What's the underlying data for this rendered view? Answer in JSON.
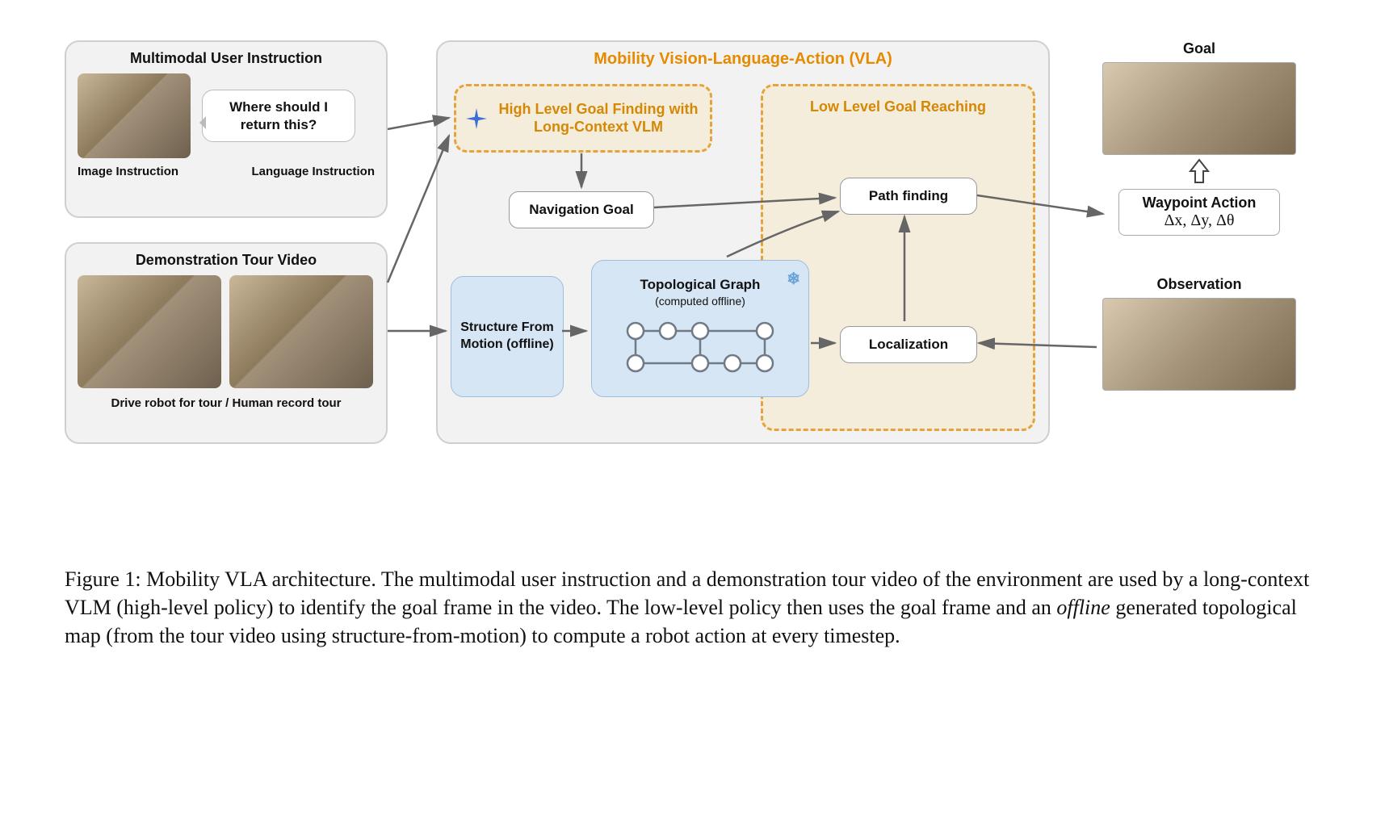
{
  "left_top": {
    "title": "Multimodal User Instruction",
    "speech": "Where should I return this?",
    "image_label": "Image Instruction",
    "lang_label": "Language Instruction"
  },
  "left_bot": {
    "title": "Demonstration Tour Video",
    "caption": "Drive robot for tour  /  Human record tour"
  },
  "center": {
    "title": "Mobility Vision-Language-Action (VLA)",
    "high_level": "High Level Goal Finding with Long-Context VLM",
    "low_level": "Low Level Goal Reaching",
    "nav_goal": "Navigation Goal",
    "path_finding": "Path finding",
    "localization": "Localization",
    "sfm": "Structure From Motion (offline)",
    "topo_label": "Topological Graph",
    "topo_sub": "(computed offline)"
  },
  "right": {
    "goal": "Goal",
    "waypoint": "Waypoint Action",
    "waypoint_math": "Δx, Δy, Δθ",
    "observation": "Observation"
  },
  "caption": {
    "prefix": "Figure 1: Mobility VLA architecture. The multimodal user instruction and a demonstration tour video of the environment are used by a long-context VLM (high-level policy) to identify the goal frame in the video. The low-level policy then uses the goal frame and an ",
    "italic": "offline",
    "suffix": " generated topological map (from the tour video using structure-from-motion) to compute a robot action at every timestep."
  }
}
